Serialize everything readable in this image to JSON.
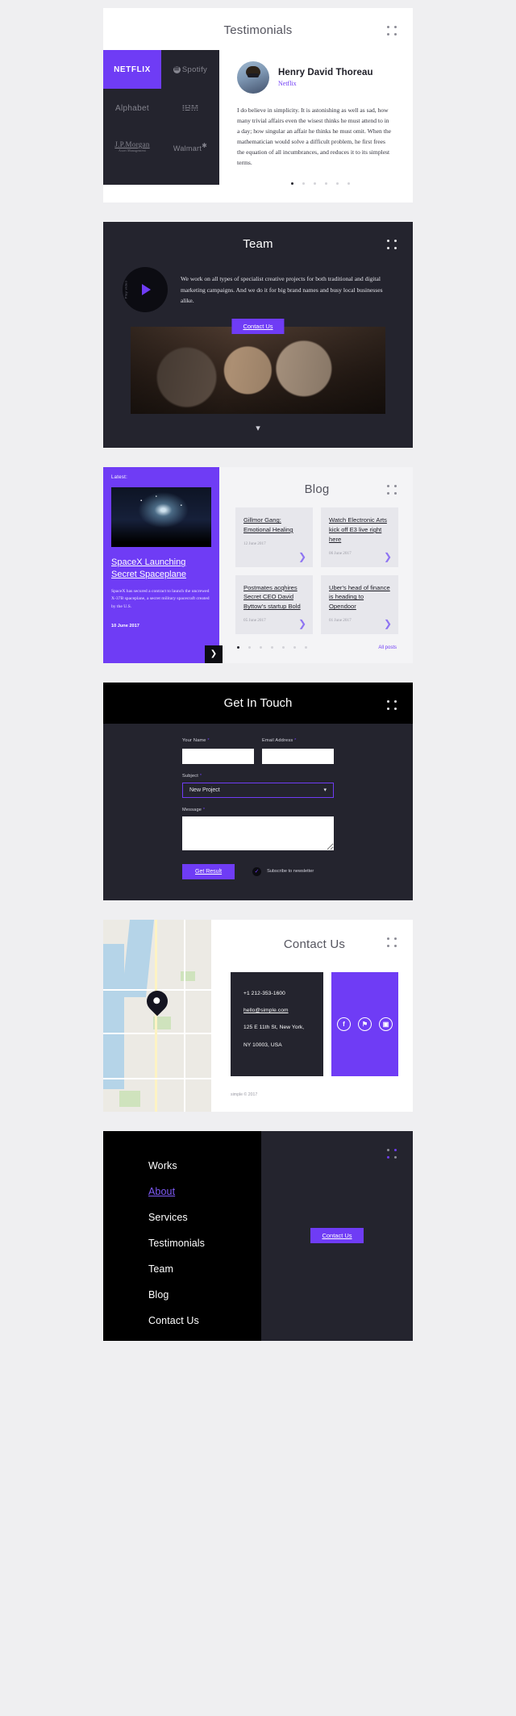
{
  "testimonials": {
    "title": "Testimonials",
    "logos": [
      {
        "name": "NETFLIX",
        "icon": "netflix-logo",
        "active": true
      },
      {
        "name": "Spotify",
        "icon": "spotify-logo",
        "active": false
      },
      {
        "name": "Alphabet",
        "icon": "alphabet-logo",
        "active": false
      },
      {
        "name": "IBM",
        "icon": "ibm-logo",
        "active": false
      },
      {
        "name": "J.P.Morgan",
        "sub": "Asset Management",
        "icon": "jpmorgan-logo",
        "active": false
      },
      {
        "name": "Walmart",
        "icon": "walmart-logo",
        "active": false
      }
    ],
    "person": {
      "name": "Henry David Thoreau",
      "company": "Netflix"
    },
    "quote": "I do believe in simplicity. It is astonishing as well as sad, how many trivial affairs even the wisest thinks he must attend to in a day; how singular an affair he thinks he must omit. When the mathematician would solve a difficult problem, he first frees the equation of all incumbrances, and reduces it to its simplest terms.",
    "slides": 6,
    "active_slide": 0
  },
  "team": {
    "title": "Team",
    "play_label": "Play video",
    "description": "We work on all types of specialist creative projects for both traditional and digital marketing campaigns. And we do it for big brand names and busy local businesses alike.",
    "contact_button": "Contact Us",
    "scroll_icon": "chevron-down-icon"
  },
  "blog": {
    "title": "Blog",
    "latest_label": "Latest:",
    "featured": {
      "title": "SpaceX Launching Secret Spaceplane",
      "excerpt": "SpaceX has secured a contract to launch the uncrewed X-37B spaceplane, a secret military spacecraft created by the U.S.",
      "date": "10 June 2017"
    },
    "posts": [
      {
        "title": "Gillmor Gang: Emotional Healing",
        "date": "12 June 2017"
      },
      {
        "title": "Watch Electronic Arts kick off E3 live right here",
        "date": "06 June 2017"
      },
      {
        "title": "Postmates acqhires Secret CEO David Byttow's startup Bold",
        "date": "05 June 2017"
      },
      {
        "title": "Uber's head of finance is heading to Opendoor",
        "date": "01 June 2017"
      }
    ],
    "slides": 7,
    "active_slide": 0,
    "all_posts_label": "All posts"
  },
  "get_in_touch": {
    "title": "Get In Touch",
    "fields": {
      "name_label": "Your Name",
      "name_value": "",
      "email_label": "Email Address",
      "email_value": "",
      "subject_label": "Subject",
      "subject_value": "New Project",
      "subject_options": [
        "New Project"
      ],
      "message_label": "Message",
      "message_value": ""
    },
    "required_mark": "*",
    "submit_label": "Get Result",
    "newsletter_label": "Subscribe to newsletter",
    "newsletter_checked": true
  },
  "contact": {
    "title": "Contact Us",
    "phone": "+1 212-353-1600",
    "email": "hello@simple.com",
    "address_line1": "125 E 11th St, New York,",
    "address_line2": "NY 10003, USA",
    "socials": [
      {
        "name": "facebook-icon",
        "glyph": "f"
      },
      {
        "name": "twitter-icon",
        "glyph": "⚑"
      },
      {
        "name": "instagram-icon",
        "glyph": "▣"
      }
    ],
    "copyright": "simple © 2017"
  },
  "footer": {
    "nav": [
      {
        "label": "Works",
        "active": false
      },
      {
        "label": "About",
        "active": true
      },
      {
        "label": "Services",
        "active": false
      },
      {
        "label": "Testimonials",
        "active": false
      },
      {
        "label": "Team",
        "active": false
      },
      {
        "label": "Blog",
        "active": false
      },
      {
        "label": "Contact Us",
        "active": false
      }
    ],
    "contact_button": "Contact Us"
  },
  "colors": {
    "accent": "#6f3cf5",
    "dark": "#24242e",
    "black": "#000000",
    "page_bg": "#efeff1"
  }
}
